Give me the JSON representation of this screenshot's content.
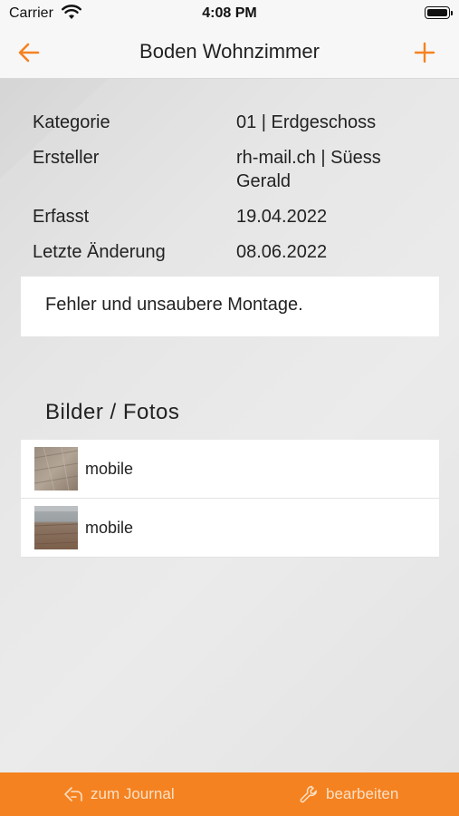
{
  "status": {
    "carrier": "Carrier",
    "time": "4:08 PM"
  },
  "nav": {
    "title": "Boden Wohnzimmer",
    "back_icon": "arrow-left-icon",
    "add_icon": "plus-icon",
    "accent": "#f58220"
  },
  "details": [
    {
      "label": "Kategorie",
      "value": "01 | Erdgeschoss"
    },
    {
      "label": "Ersteller",
      "value": "rh-mail.ch | Süess Gerald"
    },
    {
      "label": "Erfasst",
      "value": "19.04.2022"
    },
    {
      "label": "Letzte Änderung",
      "value": "08.06.2022"
    }
  ],
  "description": "Fehler und unsaubere Montage.",
  "photos": {
    "title": "Bilder / Fotos",
    "items": [
      {
        "label": "mobile"
      },
      {
        "label": "mobile"
      }
    ]
  },
  "bottom": {
    "journal_label": "zum Journal",
    "edit_label": "bearbeiten",
    "bar_color": "#f58220"
  }
}
